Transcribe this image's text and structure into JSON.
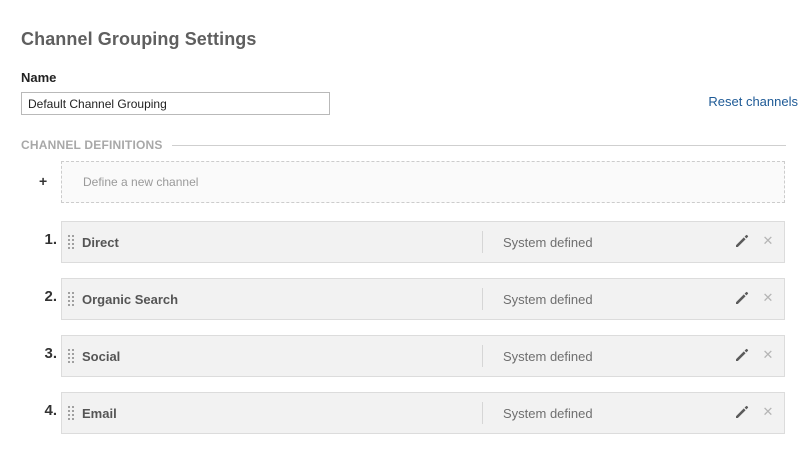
{
  "page_title": "Channel Grouping Settings",
  "name_field": {
    "label": "Name",
    "value": "Default Channel Grouping"
  },
  "reset_label": "Reset channels",
  "section_header": "CHANNEL DEFINITIONS",
  "add_channel": {
    "icon": "plus-icon",
    "symbol": "+",
    "label": "Define a new channel"
  },
  "channels": [
    {
      "number": "1.",
      "name": "Direct",
      "type": "System defined"
    },
    {
      "number": "2.",
      "name": "Organic Search",
      "type": "System defined"
    },
    {
      "number": "3.",
      "name": "Social",
      "type": "System defined"
    },
    {
      "number": "4.",
      "name": "Email",
      "type": "System defined"
    }
  ],
  "icons": {
    "drag": "drag-handle-icon",
    "edit": "pencil-icon",
    "delete": "close-icon"
  },
  "colors": {
    "link": "#1e5a96",
    "title": "#5f5f5f",
    "row_background": "#f2f2f2",
    "muted_text": "#a8a8a8"
  }
}
